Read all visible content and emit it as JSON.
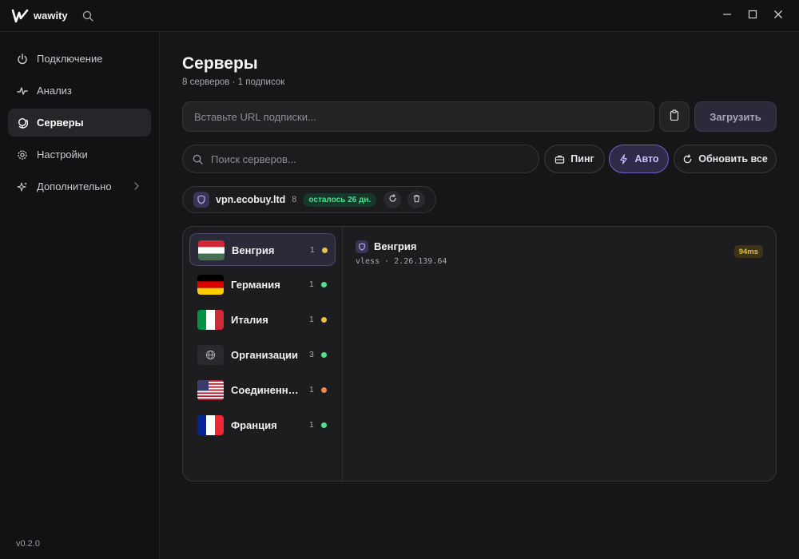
{
  "app": {
    "name": "wawity",
    "version": "v0.2.0"
  },
  "icons": {
    "logo": "logo-icon",
    "search": "search-icon",
    "minimize": "minimize-icon",
    "maximize": "maximize-icon",
    "close": "close-icon",
    "power": "power-icon",
    "pulse": "pulse-icon",
    "globe": "globe-icon",
    "gear": "gear-icon",
    "sparkles": "sparkles-icon",
    "clipboard": "clipboard-icon",
    "briefcase": "briefcase-icon",
    "bolt": "bolt-icon",
    "refresh": "refresh-icon",
    "trash": "trash-icon",
    "shield": "shield-icon"
  },
  "colors": {
    "accent": "#6f61c8",
    "status_green": "#4ee08f",
    "status_yellow": "#e8c24a",
    "status_orange": "#f08a4b"
  },
  "sidebar": {
    "items": [
      {
        "label": "Подключение",
        "icon": "power-icon",
        "active": false
      },
      {
        "label": "Анализ",
        "icon": "pulse-icon",
        "active": false
      },
      {
        "label": "Серверы",
        "icon": "globe-icon",
        "active": true
      },
      {
        "label": "Настройки",
        "icon": "gear-icon",
        "active": false
      },
      {
        "label": "Дополнительно",
        "icon": "sparkles-icon",
        "active": false
      }
    ]
  },
  "main": {
    "title": "Серверы",
    "subtitle": "8 серверов · 1 подписок",
    "url_placeholder": "Вставьте URL подписки...",
    "load_label": "Загрузить",
    "search_placeholder": "Поиск серверов...",
    "ping_label": "Пинг",
    "auto_label": "Авто",
    "refresh_all_label": "Обновить все"
  },
  "subscription": {
    "name": "vpn.ecobuy.ltd",
    "count": "8",
    "days_left": "осталось 26 дн."
  },
  "countries": [
    {
      "name": "Венгрия",
      "count": "1",
      "status": "yellow",
      "flag": "hungary",
      "selected": true
    },
    {
      "name": "Германия",
      "count": "1",
      "status": "green",
      "flag": "germany",
      "selected": false
    },
    {
      "name": "Италия",
      "count": "1",
      "status": "yellow",
      "flag": "italy",
      "selected": false
    },
    {
      "name": "Организации",
      "count": "3",
      "status": "green",
      "flag": "globe",
      "selected": false
    },
    {
      "name": "Соединенные Штаты",
      "count": "1",
      "status": "orange",
      "flag": "usa",
      "selected": false
    },
    {
      "name": "Франция",
      "count": "1",
      "status": "green",
      "flag": "france",
      "selected": false
    }
  ],
  "server": {
    "name": "Венгрия",
    "info": "vless · 2.26.139.64",
    "ping": "94ms"
  }
}
